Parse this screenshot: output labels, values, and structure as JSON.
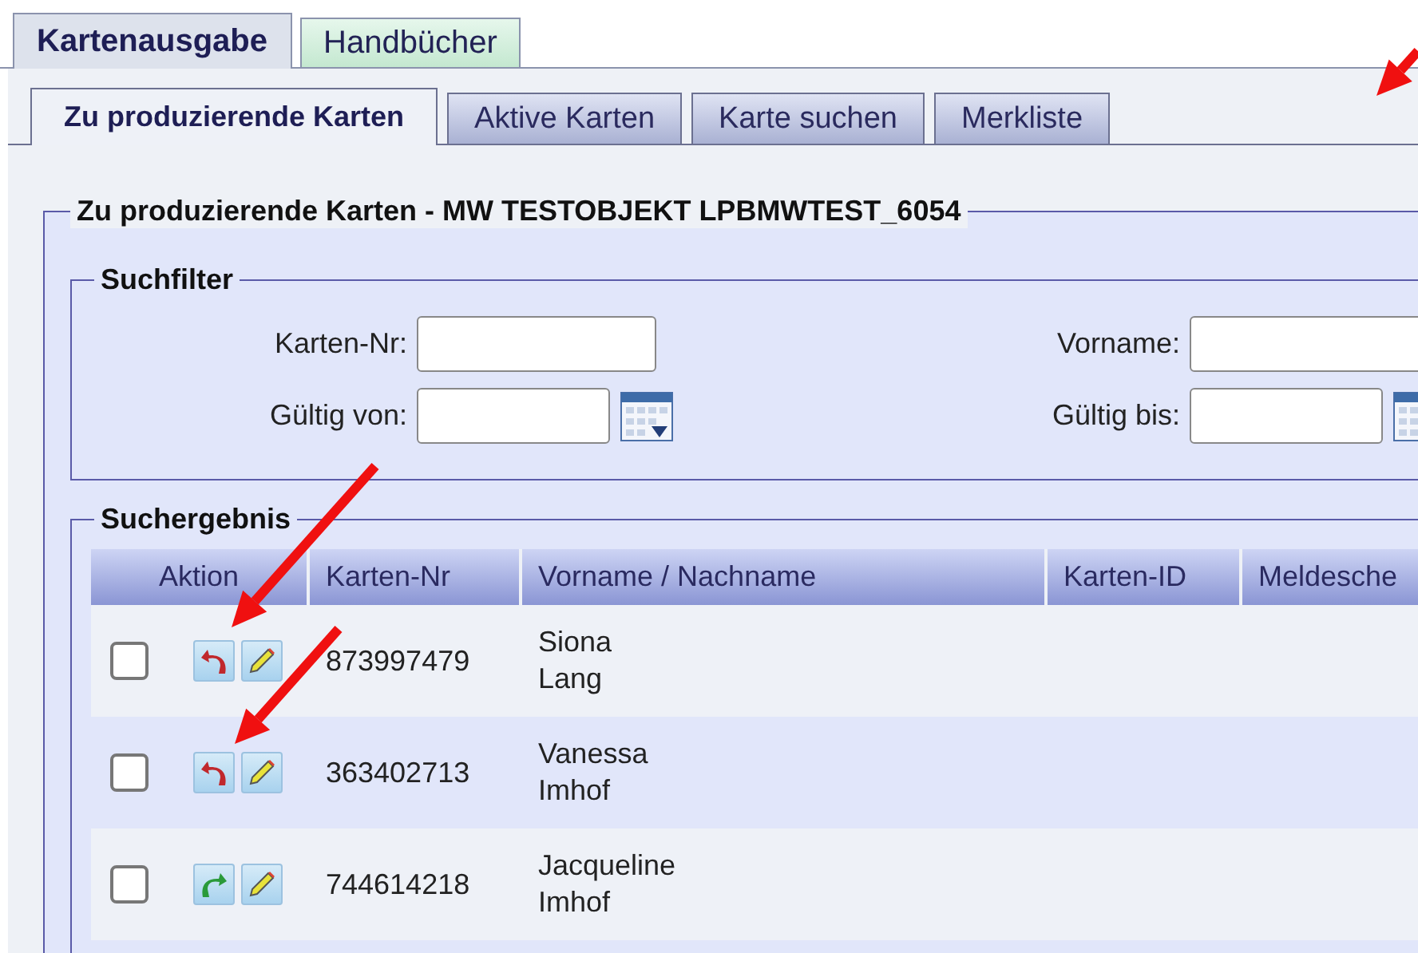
{
  "top_tabs": [
    {
      "label": "Kartenausgabe",
      "selected": true
    },
    {
      "label": "Handbücher",
      "selected": false
    }
  ],
  "sub_tabs": [
    {
      "label": "Zu produzierende Karten",
      "selected": true
    },
    {
      "label": "Aktive Karten",
      "selected": false
    },
    {
      "label": "Karte suchen",
      "selected": false
    },
    {
      "label": "Merkliste",
      "selected": false
    }
  ],
  "panel": {
    "title": "Zu produzierende Karten - MW TESTOBJEKT LPBMWTEST_6054"
  },
  "search_filter": {
    "title": "Suchfilter",
    "fields": [
      {
        "label": "Karten-Nr:",
        "kind": "text"
      },
      {
        "label": "Vorname:",
        "kind": "text"
      },
      {
        "label": "Gültig von:",
        "kind": "date"
      },
      {
        "label": "Gültig bis:",
        "kind": "date"
      }
    ]
  },
  "results": {
    "title": "Suchergebnis",
    "columns": [
      "Aktion",
      "Karten-Nr",
      "Vorname / Nachname",
      "Karten-ID",
      "Meldesche"
    ],
    "rows": [
      {
        "checked": false,
        "kind": "revert",
        "card_number": "873997479",
        "first_name": "Siona",
        "last_name": "Lang"
      },
      {
        "checked": false,
        "kind": "revert",
        "card_number": "363402713",
        "first_name": "Vanessa",
        "last_name": "Imhof"
      },
      {
        "checked": false,
        "kind": "forward",
        "card_number": "744614218",
        "first_name": "Jacqueline",
        "last_name": "Imhof"
      }
    ]
  }
}
